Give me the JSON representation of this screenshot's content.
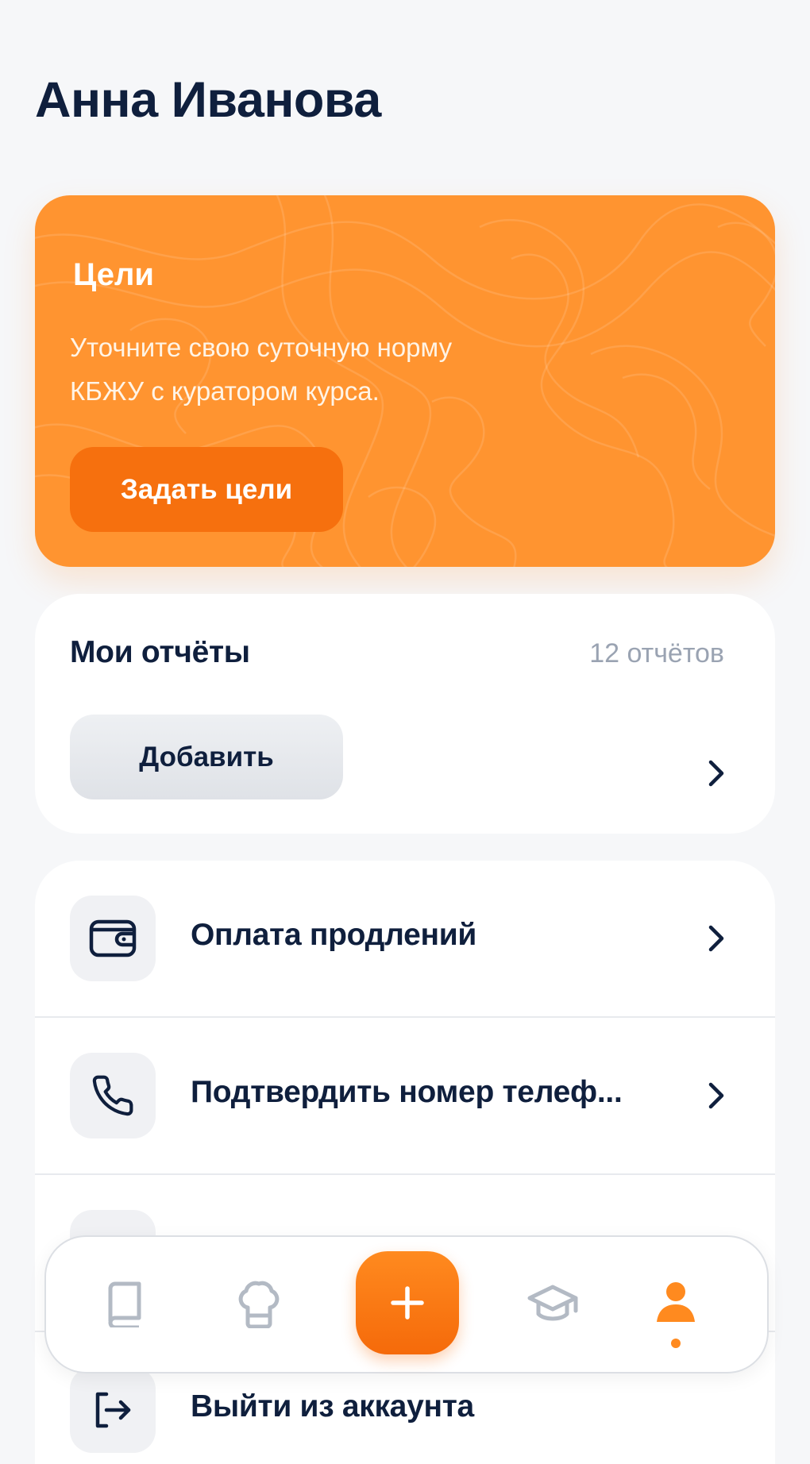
{
  "profile": {
    "name": "Анна Иванова"
  },
  "goals": {
    "title": "Цели",
    "text": "Уточните свою суточную норму КБЖУ с куратором курса.",
    "button_label": "Задать цели"
  },
  "reports": {
    "title": "Мои отчёты",
    "count": "12 отчётов",
    "add_label": "Добавить"
  },
  "menu": {
    "items": [
      {
        "label": "Оплата продлений",
        "icon": "wallet-icon"
      },
      {
        "label": "Подтвердить номер телеф...",
        "icon": "phone-icon"
      },
      {
        "label": "",
        "icon": "hidden-icon"
      },
      {
        "label": "Выйти из аккаунта",
        "icon": "logout-icon"
      }
    ]
  },
  "tabbar": {
    "tabs": [
      {
        "name": "book",
        "icon": "book-icon"
      },
      {
        "name": "recipes",
        "icon": "chef-hat-icon"
      },
      {
        "name": "add",
        "icon": "plus-icon"
      },
      {
        "name": "courses",
        "icon": "graduation-cap-icon"
      },
      {
        "name": "profile",
        "icon": "user-icon",
        "active": true
      }
    ]
  },
  "colors": {
    "accent": "#ff9430",
    "accent_dark": "#f6700e",
    "text": "#0f1f3d",
    "muted": "#9aa3b2",
    "inactive_icon": "#b3bac4"
  }
}
